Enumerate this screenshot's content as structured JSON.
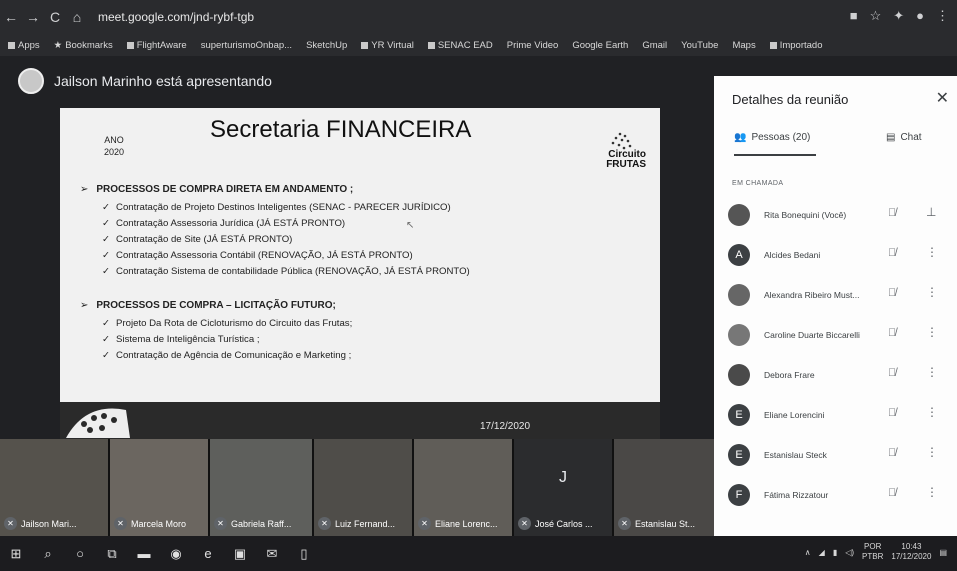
{
  "browser": {
    "url": "meet.google.com/jnd-rybf-tgb",
    "nav": [
      "←",
      "→",
      "C",
      "⌂"
    ],
    "bookmarks": [
      "Apps",
      "Bookmarks",
      "FlightAware",
      "superturismoOnbap...",
      "SketchUp",
      "YR Virtual",
      "SENAC EAD",
      "Prime Video",
      "Google Earth",
      "Gmail",
      "YouTube",
      "Maps",
      "Importado"
    ]
  },
  "presenter": {
    "text": "Jailson Marinho está apresentando"
  },
  "slide": {
    "title": "Secretaria FINANCEIRA",
    "year_label": "ANO",
    "year": "2020",
    "logo_text": "Circuito\nFRUTAS",
    "section1": "PROCESSOS DE COMPRA DIRETA EM ANDAMENTO ;",
    "items1": [
      "Contratação de Projeto Destinos Inteligentes (SENAC - PARECER JURÍDICO)",
      "Contratação Assessoria Jurídica (JÁ ESTÁ PRONTO)",
      "Contratação de Site (JÁ ESTÁ PRONTO)",
      "Contratação Assessoria Contábil (RENOVAÇÃO, JÁ ESTÁ PRONTO)",
      "Contratação Sistema de contabilidade Pública (RENOVAÇÃO, JÁ ESTÁ PRONTO)"
    ],
    "section2": "PROCESSOS DE COMPRA – LICITAÇÃO FUTURO;",
    "items2": [
      "Projeto Da Rota de Cicloturismo do Circuito das Frutas;",
      "Sistema de Inteligência Turística ;",
      "Contratação de Agência de Comunicação e Marketing ;"
    ],
    "date": "17/12/2020"
  },
  "panel": {
    "title": "Detalhes da reunião",
    "tab_people": "Pessoas (20)",
    "tab_chat": "Chat",
    "section": "EM CHAMADA",
    "people": [
      {
        "name": "Rita Bonequini (Você)",
        "initial": ""
      },
      {
        "name": "Alcides Bedani",
        "initial": "A"
      },
      {
        "name": "Alexandra Ribeiro Must...",
        "initial": ""
      },
      {
        "name": "Caroline Duarte Biccarelli",
        "initial": ""
      },
      {
        "name": "Debora Frare",
        "initial": ""
      },
      {
        "name": "Eliane Lorencini",
        "initial": "E"
      },
      {
        "name": "Estanislau Steck",
        "initial": "E"
      },
      {
        "name": "Fátima Rizzatour",
        "initial": "F"
      }
    ]
  },
  "tiles": [
    {
      "name": "Jailson Mari...",
      "initial": ""
    },
    {
      "name": "Marcela Moro",
      "initial": ""
    },
    {
      "name": "Gabriela Raff...",
      "initial": ""
    },
    {
      "name": "Luiz Fernand...",
      "initial": ""
    },
    {
      "name": "Eliane Lorenc...",
      "initial": ""
    },
    {
      "name": "José Carlos ...",
      "initial": "J"
    },
    {
      "name": "Estanislau St...",
      "initial": ""
    }
  ],
  "tray": {
    "lang": "POR",
    "layout": "PTBR",
    "time": "10:43",
    "date": "17/12/2020"
  }
}
